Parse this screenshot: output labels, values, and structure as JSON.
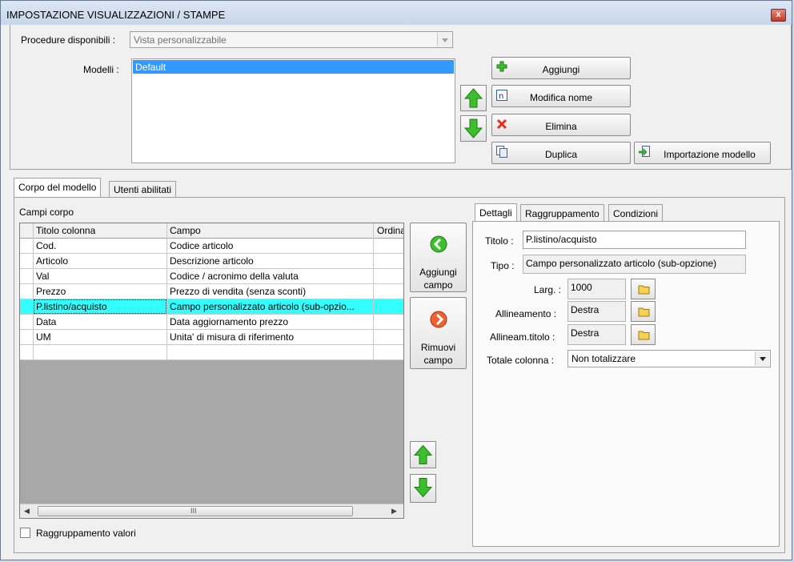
{
  "window": {
    "title": "IMPOSTAZIONE VISUALIZZAZIONI / STAMPE",
    "close_label": "x"
  },
  "header": {
    "procedure_label": "Procedure disponibili :",
    "procedure_value": "Vista personalizzabile",
    "modelli_label": "Modelli :",
    "modelli_items": [
      "Default"
    ]
  },
  "model_buttons": {
    "aggiungi": "Aggiungi",
    "modifica": "Modifica nome",
    "elimina": "Elimina",
    "duplica": "Duplica",
    "importazione": "Importazione modello"
  },
  "main_tabs": [
    "Corpo del modello",
    "Utenti abilitati"
  ],
  "campi": {
    "label": "Campi corpo",
    "columns": [
      "Titolo colonna",
      "Campo",
      "Ordina"
    ],
    "rows": [
      {
        "titolo": "Cod.",
        "campo": "Codice articolo"
      },
      {
        "titolo": "Articolo",
        "campo": "Descrizione articolo"
      },
      {
        "titolo": "Val",
        "campo": "Codice / acronimo della valuta"
      },
      {
        "titolo": "Prezzo",
        "campo": "Prezzo di vendita (senza sconti)"
      },
      {
        "titolo": "P.listino/acquisto",
        "campo": "Campo personalizzato articolo (sub-opzio..."
      },
      {
        "titolo": "Data",
        "campo": "Data aggiornamento prezzo"
      },
      {
        "titolo": "UM",
        "campo": "Unita' di misura di riferimento"
      },
      {
        "titolo": "",
        "campo": ""
      }
    ],
    "selected_index": 4,
    "scroll_thumb": "III"
  },
  "middle_buttons": {
    "aggiungi_line1": "Aggiungi",
    "aggiungi_line2": "campo",
    "rimuovi_line1": "Rimuovi",
    "rimuovi_line2": "campo"
  },
  "raggruppamento_checkbox": {
    "label": "Raggruppamento valori",
    "checked": false
  },
  "detail_tabs": [
    "Dettagli",
    "Raggruppamento",
    "Condizioni"
  ],
  "details": {
    "titolo_label": "Titolo :",
    "titolo_value": "P.listino/acquisto",
    "tipo_label": "Tipo :",
    "tipo_value": "Campo personalizzato articolo (sub-opzione)",
    "larg_label": "Larg. :",
    "larg_value": "1000",
    "allineamento_label": "Allineamento :",
    "allineamento_value": "Destra",
    "allineam_titolo_label": "Allineam.titolo :",
    "allineam_titolo_value": "Destra",
    "totale_label": "Totale colonna :",
    "totale_value": "Non totalizzare"
  },
  "colors": {
    "selection": "#33ffff",
    "list_selection": "#3399ff",
    "titlebar": "#d2e0f2"
  }
}
